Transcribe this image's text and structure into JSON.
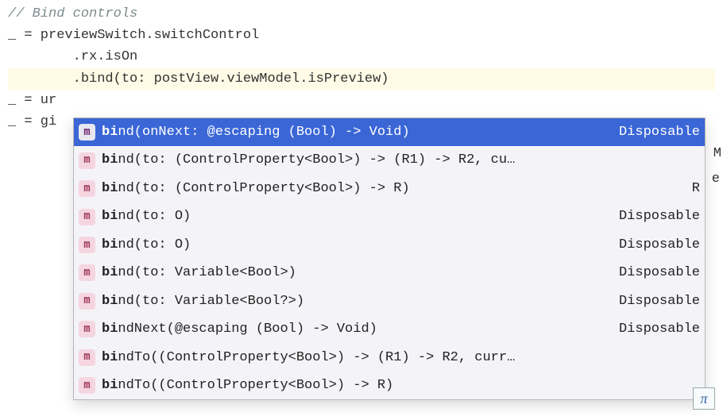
{
  "code": {
    "comment": "// Bind controls",
    "line2": "_ = previewSwitch.switchControl",
    "line3": "        .rx.isOn",
    "line4": "        .bind(to: postView.viewModel.isPreview)",
    "line5_prefix": "_ = ur",
    "line5_suffix_char": "M",
    "line6_prefix": "_ = gi",
    "line6_suffix_char": "e"
  },
  "autocomplete": {
    "badge_char": "m",
    "items": [
      {
        "bold": "bi",
        "rest": "nd(onNext: @escaping (Bool) -> Void)",
        "ret": "Disposable",
        "selected": true
      },
      {
        "bold": "bi",
        "rest": "nd(to: (ControlProperty<Bool>) -> (R1) -> R2, cu…",
        "ret": "",
        "selected": false
      },
      {
        "bold": "bi",
        "rest": "nd(to: (ControlProperty<Bool>) -> R)",
        "ret": "R",
        "selected": false
      },
      {
        "bold": "bi",
        "rest": "nd(to: O)",
        "ret": "Disposable",
        "selected": false
      },
      {
        "bold": "bi",
        "rest": "nd(to: O)",
        "ret": "Disposable",
        "selected": false
      },
      {
        "bold": "bi",
        "rest": "nd(to: Variable<Bool>)",
        "ret": "Disposable",
        "selected": false
      },
      {
        "bold": "bi",
        "rest": "nd(to: Variable<Bool?>)",
        "ret": "Disposable",
        "selected": false
      },
      {
        "bold": "bi",
        "rest": "ndNext(@escaping (Bool) -> Void)",
        "ret": "Disposable",
        "selected": false
      },
      {
        "bold": "bi",
        "rest": "ndTo((ControlProperty<Bool>) -> (R1) -> R2, curr…",
        "ret": "",
        "selected": false
      },
      {
        "bold": "bi",
        "rest": "ndTo((ControlProperty<Bool>) -> R)",
        "ret": "",
        "selected": false
      }
    ]
  },
  "corner_symbol": "π"
}
